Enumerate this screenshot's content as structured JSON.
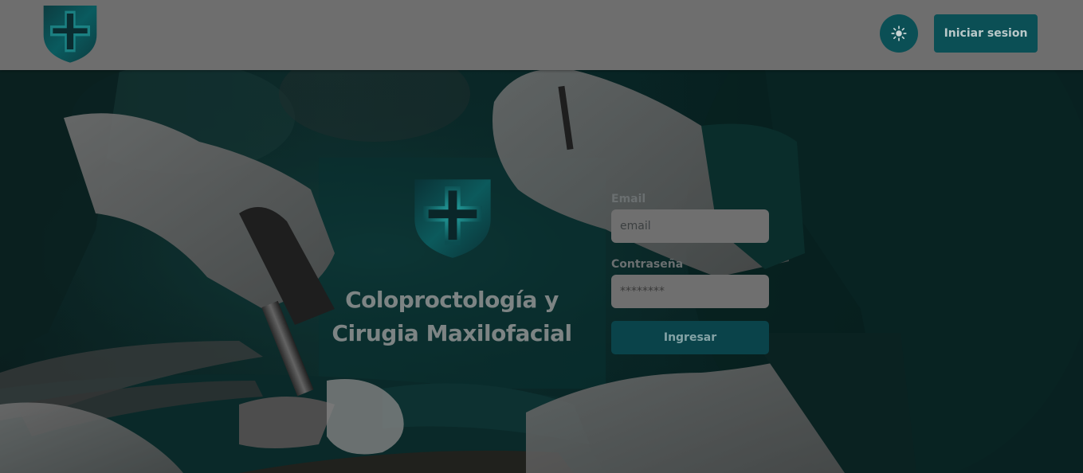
{
  "header": {
    "theme_toggle_icon": "sun-icon",
    "login_button_label": "Iniciar sesion"
  },
  "brand": {
    "title_line1": "Coloproctología y",
    "title_line2": "Cirugia Maxilofacial",
    "logo_icon": "medical-cross-shield-icon"
  },
  "login_form": {
    "email_label": "Email",
    "email_placeholder": "email",
    "email_value": "",
    "password_label": "Contraseña",
    "password_value": "********",
    "submit_label": "Ingresar"
  },
  "colors": {
    "header_bg": "#6e6e6e",
    "accent": "#0b4f55",
    "hero_teal": "#0e3f3f",
    "input_bg": "#6f6f6f"
  }
}
